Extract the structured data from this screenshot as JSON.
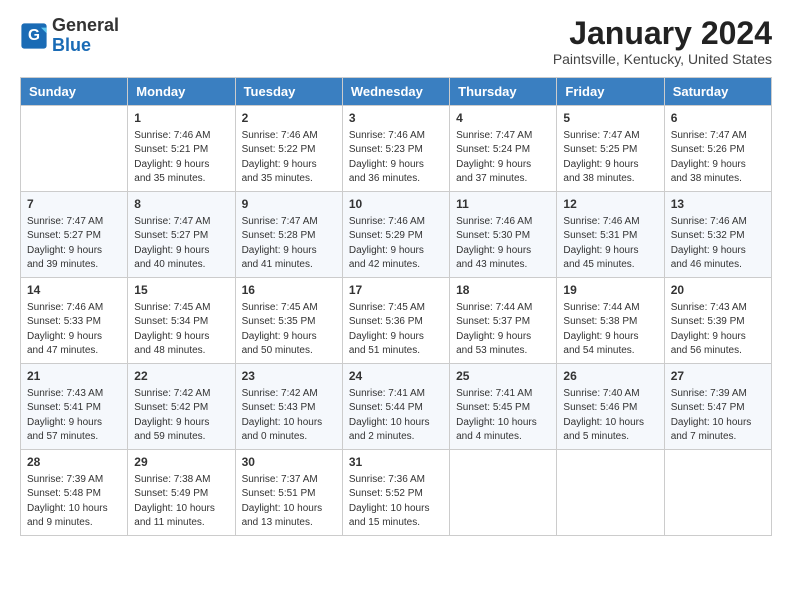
{
  "logo": {
    "general": "General",
    "blue": "Blue"
  },
  "title": "January 2024",
  "subtitle": "Paintsville, Kentucky, United States",
  "days_of_week": [
    "Sunday",
    "Monday",
    "Tuesday",
    "Wednesday",
    "Thursday",
    "Friday",
    "Saturday"
  ],
  "weeks": [
    [
      {
        "day": null
      },
      {
        "day": "1",
        "sunrise": "7:46 AM",
        "sunset": "5:21 PM",
        "daylight": "9 hours and 35 minutes."
      },
      {
        "day": "2",
        "sunrise": "7:46 AM",
        "sunset": "5:22 PM",
        "daylight": "9 hours and 35 minutes."
      },
      {
        "day": "3",
        "sunrise": "7:46 AM",
        "sunset": "5:23 PM",
        "daylight": "9 hours and 36 minutes."
      },
      {
        "day": "4",
        "sunrise": "7:47 AM",
        "sunset": "5:24 PM",
        "daylight": "9 hours and 37 minutes."
      },
      {
        "day": "5",
        "sunrise": "7:47 AM",
        "sunset": "5:25 PM",
        "daylight": "9 hours and 38 minutes."
      },
      {
        "day": "6",
        "sunrise": "7:47 AM",
        "sunset": "5:26 PM",
        "daylight": "9 hours and 38 minutes."
      }
    ],
    [
      {
        "day": "7",
        "sunrise": "7:47 AM",
        "sunset": "5:27 PM",
        "daylight": "9 hours and 39 minutes."
      },
      {
        "day": "8",
        "sunrise": "7:47 AM",
        "sunset": "5:27 PM",
        "daylight": "9 hours and 40 minutes."
      },
      {
        "day": "9",
        "sunrise": "7:47 AM",
        "sunset": "5:28 PM",
        "daylight": "9 hours and 41 minutes."
      },
      {
        "day": "10",
        "sunrise": "7:46 AM",
        "sunset": "5:29 PM",
        "daylight": "9 hours and 42 minutes."
      },
      {
        "day": "11",
        "sunrise": "7:46 AM",
        "sunset": "5:30 PM",
        "daylight": "9 hours and 43 minutes."
      },
      {
        "day": "12",
        "sunrise": "7:46 AM",
        "sunset": "5:31 PM",
        "daylight": "9 hours and 45 minutes."
      },
      {
        "day": "13",
        "sunrise": "7:46 AM",
        "sunset": "5:32 PM",
        "daylight": "9 hours and 46 minutes."
      }
    ],
    [
      {
        "day": "14",
        "sunrise": "7:46 AM",
        "sunset": "5:33 PM",
        "daylight": "9 hours and 47 minutes."
      },
      {
        "day": "15",
        "sunrise": "7:45 AM",
        "sunset": "5:34 PM",
        "daylight": "9 hours and 48 minutes."
      },
      {
        "day": "16",
        "sunrise": "7:45 AM",
        "sunset": "5:35 PM",
        "daylight": "9 hours and 50 minutes."
      },
      {
        "day": "17",
        "sunrise": "7:45 AM",
        "sunset": "5:36 PM",
        "daylight": "9 hours and 51 minutes."
      },
      {
        "day": "18",
        "sunrise": "7:44 AM",
        "sunset": "5:37 PM",
        "daylight": "9 hours and 53 minutes."
      },
      {
        "day": "19",
        "sunrise": "7:44 AM",
        "sunset": "5:38 PM",
        "daylight": "9 hours and 54 minutes."
      },
      {
        "day": "20",
        "sunrise": "7:43 AM",
        "sunset": "5:39 PM",
        "daylight": "9 hours and 56 minutes."
      }
    ],
    [
      {
        "day": "21",
        "sunrise": "7:43 AM",
        "sunset": "5:41 PM",
        "daylight": "9 hours and 57 minutes."
      },
      {
        "day": "22",
        "sunrise": "7:42 AM",
        "sunset": "5:42 PM",
        "daylight": "9 hours and 59 minutes."
      },
      {
        "day": "23",
        "sunrise": "7:42 AM",
        "sunset": "5:43 PM",
        "daylight": "10 hours and 0 minutes."
      },
      {
        "day": "24",
        "sunrise": "7:41 AM",
        "sunset": "5:44 PM",
        "daylight": "10 hours and 2 minutes."
      },
      {
        "day": "25",
        "sunrise": "7:41 AM",
        "sunset": "5:45 PM",
        "daylight": "10 hours and 4 minutes."
      },
      {
        "day": "26",
        "sunrise": "7:40 AM",
        "sunset": "5:46 PM",
        "daylight": "10 hours and 5 minutes."
      },
      {
        "day": "27",
        "sunrise": "7:39 AM",
        "sunset": "5:47 PM",
        "daylight": "10 hours and 7 minutes."
      }
    ],
    [
      {
        "day": "28",
        "sunrise": "7:39 AM",
        "sunset": "5:48 PM",
        "daylight": "10 hours and 9 minutes."
      },
      {
        "day": "29",
        "sunrise": "7:38 AM",
        "sunset": "5:49 PM",
        "daylight": "10 hours and 11 minutes."
      },
      {
        "day": "30",
        "sunrise": "7:37 AM",
        "sunset": "5:51 PM",
        "daylight": "10 hours and 13 minutes."
      },
      {
        "day": "31",
        "sunrise": "7:36 AM",
        "sunset": "5:52 PM",
        "daylight": "10 hours and 15 minutes."
      },
      {
        "day": null
      },
      {
        "day": null
      },
      {
        "day": null
      }
    ]
  ],
  "labels": {
    "sunrise_prefix": "Sunrise: ",
    "sunset_prefix": "Sunset: ",
    "daylight_prefix": "Daylight: "
  }
}
